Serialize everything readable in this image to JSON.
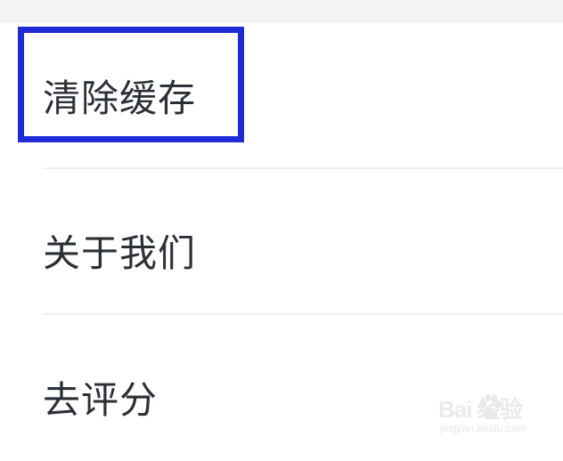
{
  "settings": {
    "items": [
      {
        "label": "清除缓存"
      },
      {
        "label": "关于我们"
      },
      {
        "label": "去评分"
      }
    ]
  },
  "watermark": {
    "logo": "Bai  经验",
    "url": "jingyan.baidu.com"
  },
  "colors": {
    "highlight": "#1f2bd6",
    "text": "#2b2f36",
    "divider": "#eeeeef",
    "top_strip": "#f4f4f6"
  }
}
